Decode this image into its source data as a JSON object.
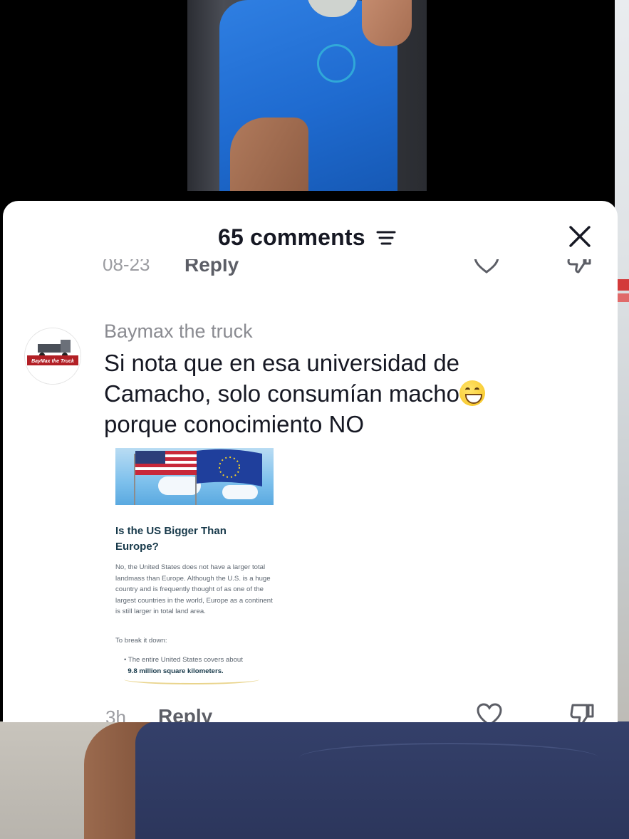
{
  "panel": {
    "title": "65 comments",
    "filter_icon": "filter-icon",
    "close_icon": "close-icon"
  },
  "previous_comment": {
    "date": "08-23",
    "reply_label": "Reply",
    "like_icon": "heart-icon",
    "dislike_icon": "dislike-icon"
  },
  "comment": {
    "username": "Baymax the truck",
    "avatar_text": "BayMax the Truck",
    "text_part1": "Si nota que en esa universidad de Camacho, solo consumían macho",
    "emoji": "grinning-face-emoji",
    "text_part2": "porque conocimiento NO",
    "attachment": {
      "title": "Is the US Bigger Than Europe?",
      "body": "No, the United States does not have a larger total landmass than Europe. Although the U.S. is a huge country and is frequently thought of as one of the largest countries in the world, Europe as a continent is still larger in total land area.",
      "subheading": "To break it down:",
      "bullet_prefix": "The entire United States covers about",
      "bullet_highlight": "9.8 million square kilometers."
    },
    "time": "3h",
    "reply_label": "Reply",
    "like_icon": "heart-icon",
    "dislike_icon": "dislike-icon"
  },
  "colors": {
    "panel_bg": "#ffffff",
    "title_text": "#161823",
    "meta_text": "#9b9ca1",
    "username_text": "#8a8b91"
  }
}
